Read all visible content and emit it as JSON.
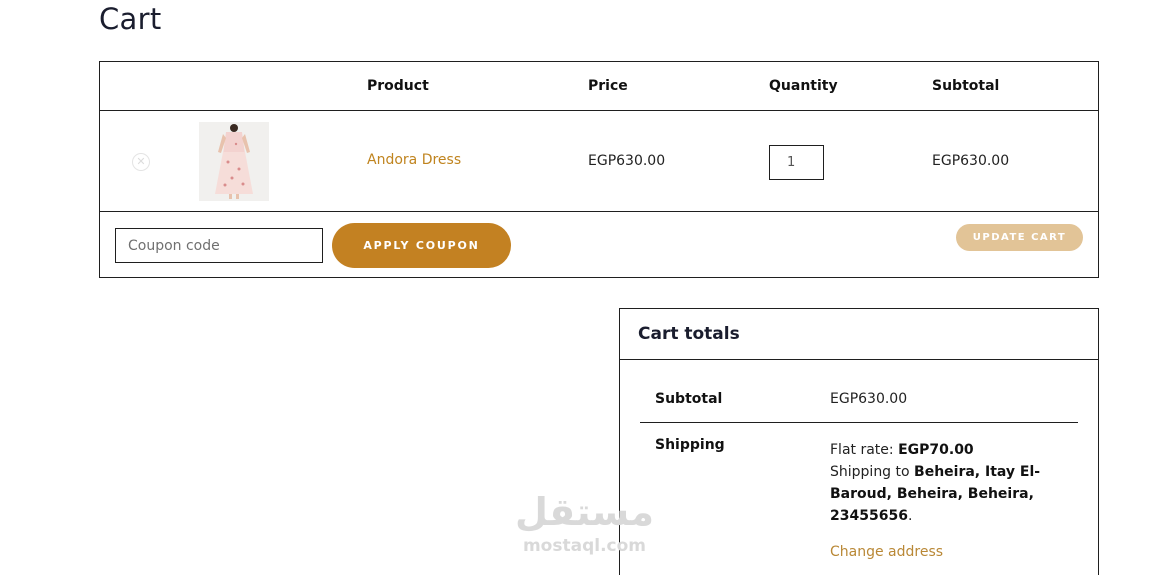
{
  "page": {
    "title": "Cart"
  },
  "cart_table": {
    "headers": {
      "product": "Product",
      "price": "Price",
      "quantity": "Quantity",
      "subtotal": "Subtotal"
    },
    "items": [
      {
        "remove_icon": "close-circle-icon",
        "image": "dress-thumbnail",
        "name": "Andora Dress",
        "price": "EGP630.00",
        "quantity": "1",
        "subtotal": "EGP630.00"
      }
    ]
  },
  "actions": {
    "coupon_placeholder": "Coupon code",
    "apply_coupon_label": "APPLY COUPON",
    "update_cart_label": "UPDATE CART"
  },
  "cart_totals": {
    "title": "Cart totals",
    "subtotal_label": "Subtotal",
    "subtotal_value": "EGP630.00",
    "shipping_label": "Shipping",
    "flat_rate_prefix": "Flat rate: ",
    "flat_rate_value": "EGP70.00",
    "shipping_to_prefix": "Shipping to ",
    "shipping_address": "Beheira, Itay El-Baroud, Beheira, Beheira, 23455656",
    "shipping_suffix": ".",
    "change_address_label": "Change address"
  },
  "watermark": {
    "arabic": "مستقل",
    "latin": "mostaql.com"
  },
  "colors": {
    "accent": "#c38122",
    "accent_light": "#e2c497",
    "link": "#b98836",
    "border": "#1f1f1f"
  }
}
